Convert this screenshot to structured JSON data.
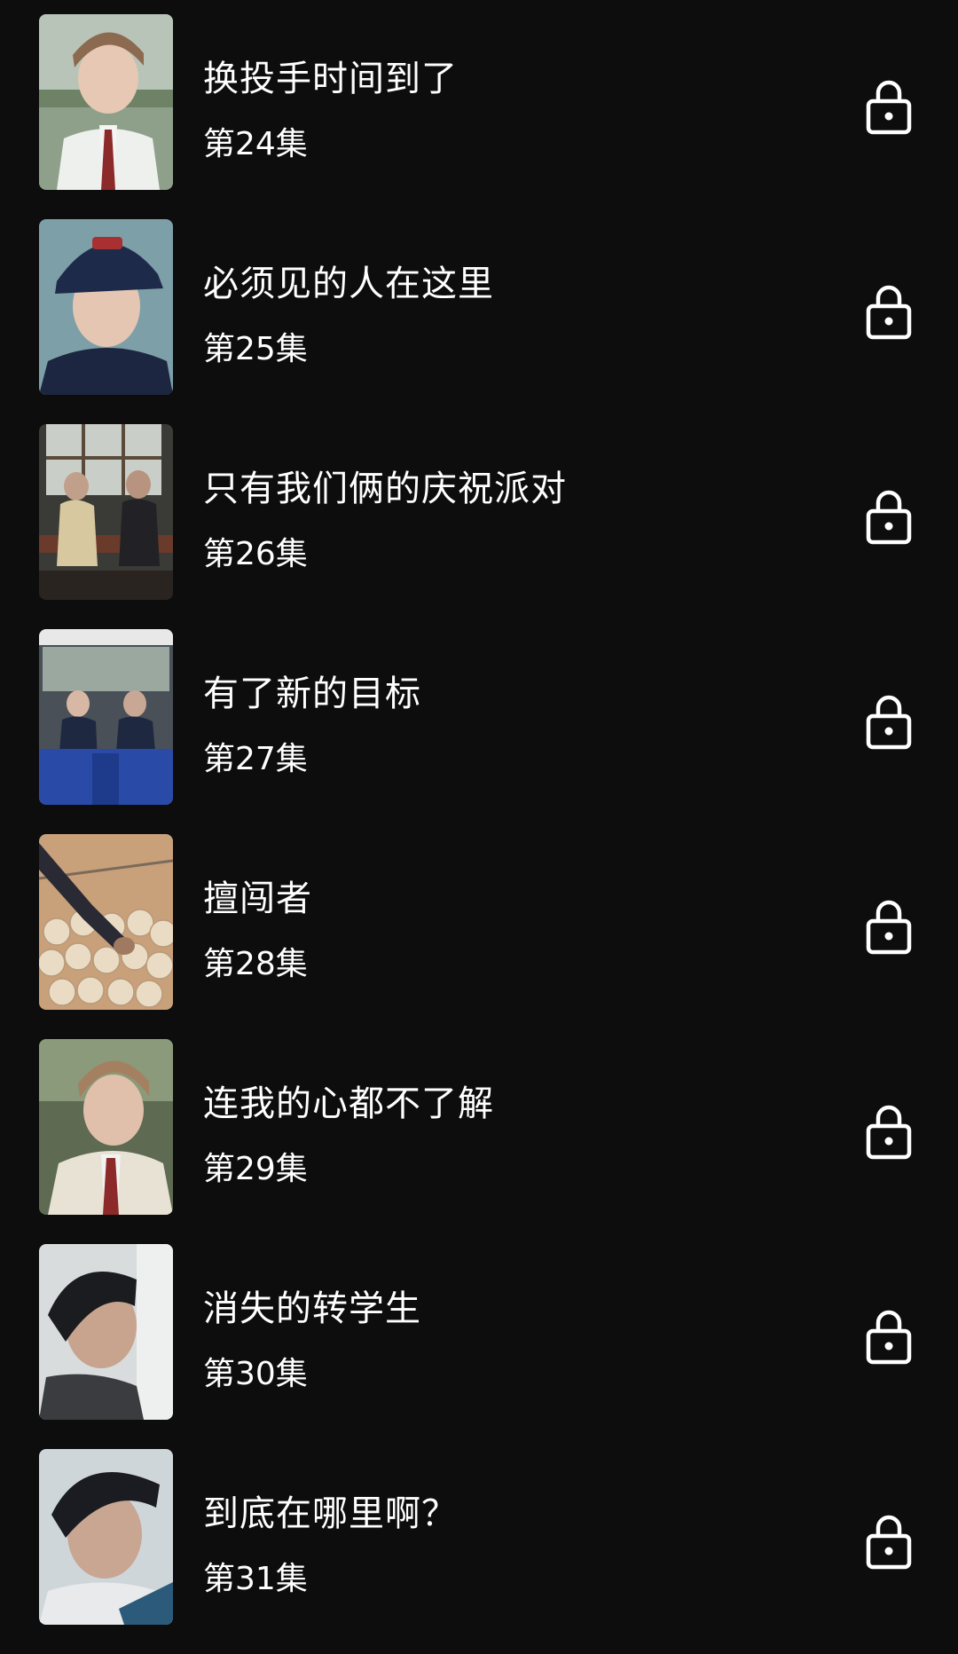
{
  "episodes": [
    {
      "title": "换投手时间到了",
      "number": "第24集",
      "thumb": "portrait-light-hair",
      "locked": true
    },
    {
      "title": "必须见的人在这里",
      "number": "第25集",
      "thumb": "portrait-baseball-cap",
      "locked": true
    },
    {
      "title": "只有我们俩的庆祝派对",
      "number": "第26集",
      "thumb": "two-people-cafeteria",
      "locked": true
    },
    {
      "title": "有了新的目标",
      "number": "第27集",
      "thumb": "two-people-bus",
      "locked": true
    },
    {
      "title": "擅闯者",
      "number": "第28集",
      "thumb": "baseball-basket",
      "locked": true
    },
    {
      "title": "连我的心都不了解",
      "number": "第29集",
      "thumb": "portrait-light-hair-outdoor",
      "locked": true
    },
    {
      "title": "消失的转学生",
      "number": "第30集",
      "thumb": "portrait-profile-dark-hair",
      "locked": true
    },
    {
      "title": "到底在哪里啊？",
      "number": "第31集",
      "thumb": "portrait-looking-up",
      "locked": true
    }
  ],
  "colors": {
    "background": "#0d0d0d",
    "text": "#ffffff",
    "lock_icon": "#ffffff"
  }
}
